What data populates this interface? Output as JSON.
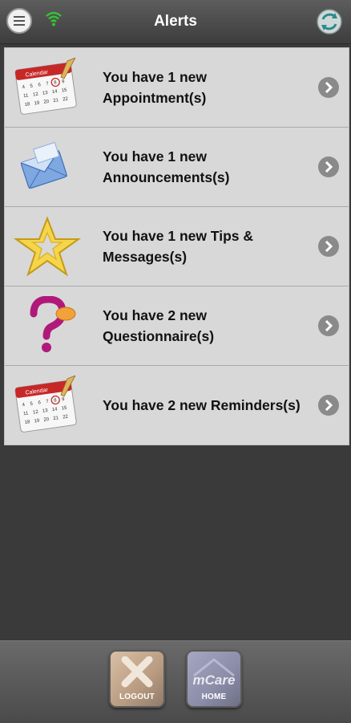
{
  "header": {
    "title": "Alerts",
    "menu_icon": "hamburger-menu-icon",
    "wifi_icon": "wifi-icon",
    "refresh_icon": "refresh-icon"
  },
  "alerts": [
    {
      "icon": "calendar-icon",
      "text": "You have 1 new Appointment(s)"
    },
    {
      "icon": "envelope-icon",
      "text": "You have 1 new Announcements(s)"
    },
    {
      "icon": "star-icon",
      "text": "You have 1 new Tips & Messages(s)"
    },
    {
      "icon": "question-mark-icon",
      "text": "You have 2 new Questionnaire(s)"
    },
    {
      "icon": "calendar-icon",
      "text": "You have 2 new Reminders(s)"
    }
  ],
  "footer": {
    "logout_label": "LOGOUT",
    "home_label": "HOME",
    "home_logo": "mCare"
  },
  "colors": {
    "header_bg": "#4a4a4a",
    "list_bg": "#d8d8d8",
    "body_bg": "#3a3a3a",
    "wifi": "#35c335"
  }
}
